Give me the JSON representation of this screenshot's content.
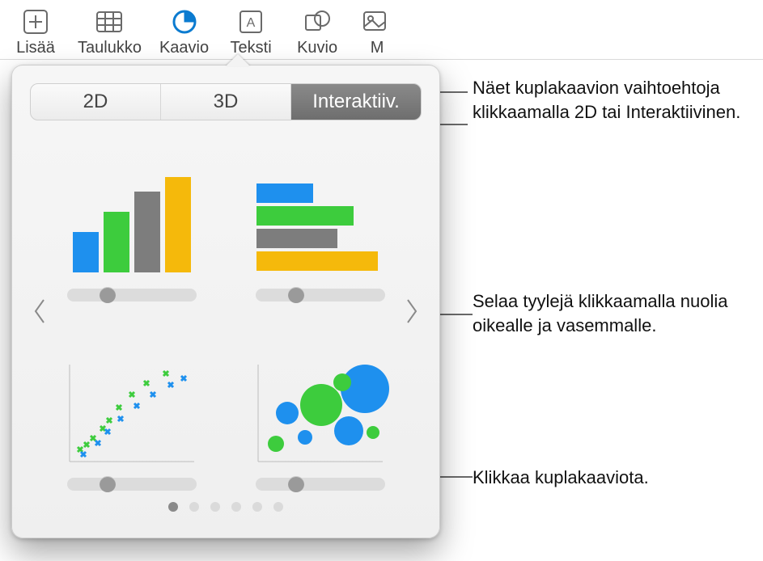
{
  "toolbar": {
    "items": [
      {
        "icon": "plus-icon",
        "label": "Lisää"
      },
      {
        "icon": "table-icon",
        "label": "Taulukko"
      },
      {
        "icon": "chart-icon",
        "label": "Kaavio",
        "active": true
      },
      {
        "icon": "text-icon",
        "label": "Teksti"
      },
      {
        "icon": "shape-icon",
        "label": "Kuvio"
      },
      {
        "icon": "media-icon",
        "label": "M"
      }
    ]
  },
  "popover": {
    "tabs": {
      "t2d": "2D",
      "t3d": "3D",
      "inter": "Interaktiiv."
    },
    "selected_tab": "inter",
    "thumbs": [
      {
        "name": "column-chart-option"
      },
      {
        "name": "horizontal-bar-chart-option"
      },
      {
        "name": "scatter-chart-option"
      },
      {
        "name": "bubble-chart-option"
      }
    ],
    "page_dots": 6,
    "current_dot": 0
  },
  "callouts": {
    "c1": "Näet kuplakaavion vaihtoehtoja klikkaamalla 2D tai Interaktiivinen.",
    "c2": "Selaa tyylejä klikkaamalla nuolia oikealle ja vasemmalle.",
    "c3": "Klikkaa kuplakaaviota."
  },
  "colors": {
    "blue": "#1e90ee",
    "green": "#3dcc3d",
    "gray": "#7d7d7d",
    "yellow": "#f5b90b"
  }
}
